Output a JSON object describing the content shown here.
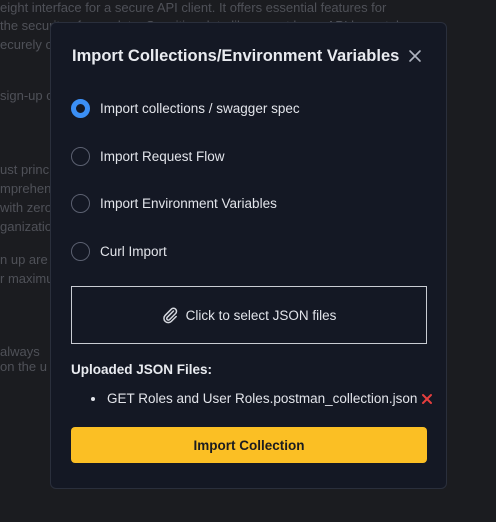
{
  "background": {
    "lines": [
      "eight interface for a secure API client. It offers essential features for",
      "the security of your data. Sensitive data like secret keys, API keys, tokens,",
      "ecurely o",
      "sign-up c",
      "ust princ",
      "mprehens",
      "with zero",
      "ganizatio",
      "n up are",
      "r maximu",
      "always",
      "on the u"
    ]
  },
  "modal": {
    "title": "Import Collections/Environment Variables",
    "close_icon": "close-icon",
    "options": [
      {
        "label": "Import collections / swagger spec",
        "checked": true
      },
      {
        "label": "Import Request Flow",
        "checked": false
      },
      {
        "label": "Import Environment Variables",
        "checked": false
      },
      {
        "label": "Curl Import",
        "checked": false
      }
    ],
    "select_files_label": "Click to select JSON files",
    "uploaded_title": "Uploaded JSON Files:",
    "files": [
      "GET Roles and User Roles.postman_collection.json"
    ],
    "import_button_label": "Import Collection"
  },
  "colors": {
    "accent": "#3b8ff5",
    "button": "#fbbf24",
    "remove": "#e53e3e",
    "modal_bg": "#141824"
  }
}
